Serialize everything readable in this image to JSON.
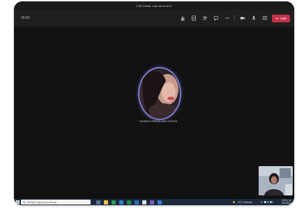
{
  "window": {
    "title": "CSE Global, más cerca de ti."
  },
  "toolbar": {
    "timer": "09:63",
    "leave_label": "Salir"
  },
  "participant": {
    "name": "CARMEN LORENA DIAZ ACOSTA"
  },
  "taskbar": {
    "search_placeholder": "Escribe aquí para buscar",
    "weather": "29°C  Soleado",
    "time": "3:18 p. m.",
    "date": "5/11/2021"
  },
  "colors": {
    "accent": "#7b7fd6",
    "leave": "#c4314b",
    "background": "#121212"
  }
}
